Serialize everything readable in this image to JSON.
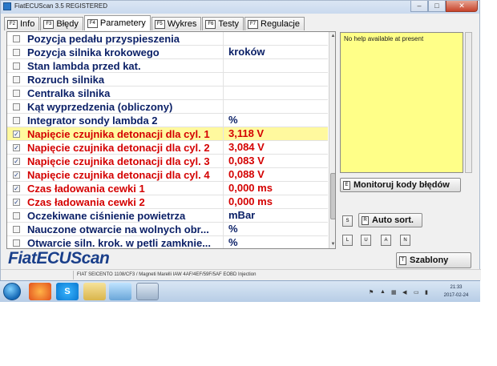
{
  "window": {
    "title": "FiatECUScan 3.5 REGISTERED"
  },
  "controls": {
    "minimize": "–",
    "maximize": "□",
    "close": "✕"
  },
  "tabs": [
    {
      "key": "F2",
      "label": "Info"
    },
    {
      "key": "F3",
      "label": "Błędy"
    },
    {
      "key": "F4",
      "label": "Parametery"
    },
    {
      "key": "F5",
      "label": "Wykres"
    },
    {
      "key": "F6",
      "label": "Testy"
    },
    {
      "key": "F7",
      "label": "Regulacje"
    }
  ],
  "params": [
    {
      "name": "Pozycja pedału przyspieszenia",
      "value": "",
      "checked": false
    },
    {
      "name": "Pozycja silnika krokowego",
      "value": "kroków",
      "checked": false
    },
    {
      "name": "Stan lambda przed kat.",
      "value": "",
      "checked": false
    },
    {
      "name": "Rozruch silnika",
      "value": "",
      "checked": false
    },
    {
      "name": "Centralka silnika",
      "value": "",
      "checked": false
    },
    {
      "name": "Kąt wyprzedzenia (obliczony)",
      "value": "",
      "checked": false
    },
    {
      "name": "Integrator sondy lambda 2",
      "value": "%",
      "checked": false
    },
    {
      "name": "Napięcie czujnika detonacji dla cyl. 1",
      "value": "3,118 V",
      "checked": true
    },
    {
      "name": "Napięcie czujnika detonacji dla cyl. 2",
      "value": "3,084 V",
      "checked": true
    },
    {
      "name": "Napięcie czujnika detonacji dla cyl. 3",
      "value": "0,083 V",
      "checked": true
    },
    {
      "name": "Napięcie czujnika detonacji dla cyl. 4",
      "value": "0,088 V",
      "checked": true
    },
    {
      "name": "Czas ładowania cewki 1",
      "value": "0,000 ms",
      "checked": true
    },
    {
      "name": "Czas ładowania cewki 2",
      "value": "0,000 ms",
      "checked": true
    },
    {
      "name": "Oczekiwane ciśnienie powietrza",
      "value": "mBar",
      "checked": false
    },
    {
      "name": "Nauczone otwarcie na wolnych obr...",
      "value": "%",
      "checked": false
    },
    {
      "name": "Otwarcie siln. krok. w petli zamknie...",
      "value": "%",
      "checked": false
    }
  ],
  "selected_row": 7,
  "help": {
    "text": "No help available at present"
  },
  "buttons": {
    "monitor": {
      "key": "E",
      "label": "Monitoruj kody błędów"
    },
    "s": {
      "key": "S"
    },
    "autosort": {
      "key": "R",
      "label": "Auto sort."
    },
    "l": {
      "key": "L"
    },
    "u": {
      "key": "U"
    },
    "a": {
      "key": "A"
    },
    "n": {
      "key": "N"
    },
    "templates": {
      "key": "T",
      "label": "Szablony"
    }
  },
  "brand": "FiatECUScan",
  "status": {
    "text": "FIAT SEICENTO 1108/CF3 / Magneti Marelli IAW 4AF/4EF/59F/5AF EOBD Injection"
  },
  "taskbar": {
    "time": "21:33",
    "date": "2017-02-24"
  },
  "colors": {
    "alert": "#d40000",
    "normal": "#0a1f66",
    "selected": "#fff99e",
    "help": "#ffff88"
  }
}
